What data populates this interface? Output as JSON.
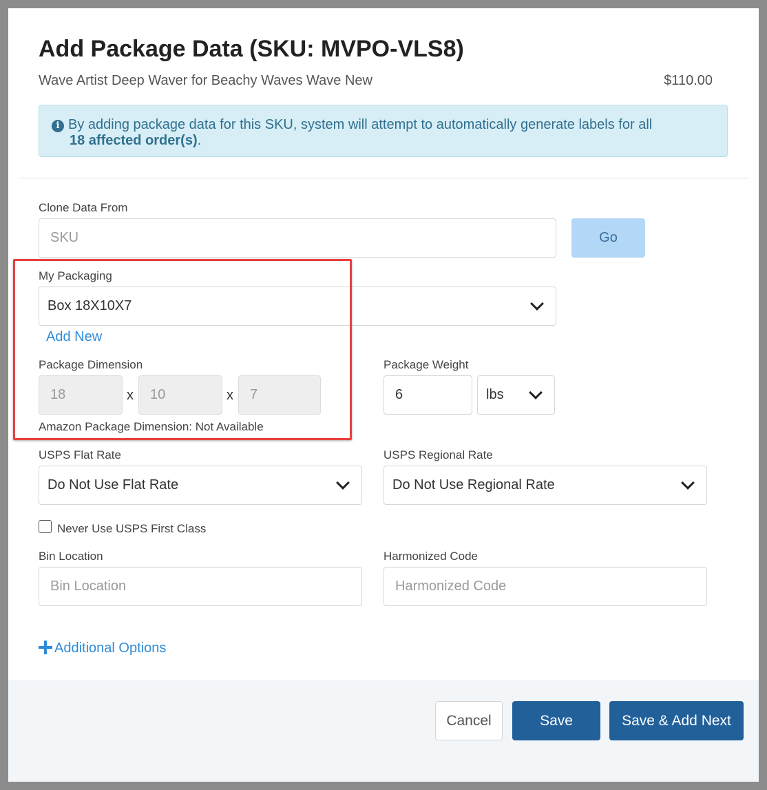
{
  "modal": {
    "title": "Add Package Data (SKU: MVPO-VLS8)",
    "product_name": "Wave Artist Deep Waver for Beachy Waves Wave New",
    "price": "$110.00"
  },
  "alert": {
    "icon": "info-icon",
    "text_before": "By adding package data for this SKU, system will attempt to automatically generate labels for all",
    "bold_count": "18 affected order(s)",
    "text_after": "."
  },
  "clone": {
    "label": "Clone Data From",
    "placeholder": "SKU",
    "button_label": "Go"
  },
  "packaging": {
    "label": "My Packaging",
    "selected": "Box 18X10X7",
    "add_new": "Add New"
  },
  "dimension": {
    "label": "Package Dimension",
    "length": "18",
    "width": "10",
    "height": "7",
    "separator": "x",
    "amazon_note": "Amazon Package Dimension: Not Available"
  },
  "weight": {
    "label": "Package Weight",
    "value": "6",
    "unit": "lbs"
  },
  "usps_flat": {
    "label": "USPS Flat Rate",
    "selected": "Do Not Use Flat Rate"
  },
  "usps_regional": {
    "label": "USPS Regional Rate",
    "selected": "Do Not Use Regional Rate"
  },
  "first_class": {
    "label": "Never Use USPS First Class",
    "checked": false
  },
  "bin": {
    "label": "Bin Location",
    "placeholder": "Bin Location"
  },
  "harmonized": {
    "label": "Harmonized Code",
    "placeholder": "Harmonized Code"
  },
  "additional_options": "Additional Options",
  "footer": {
    "cancel": "Cancel",
    "save": "Save",
    "save_next": "Save & Add Next"
  },
  "colors": {
    "primary": "#22609a",
    "link": "#2e8bd8",
    "alert_bg": "#d7eef6",
    "highlight": "#e8403f"
  }
}
